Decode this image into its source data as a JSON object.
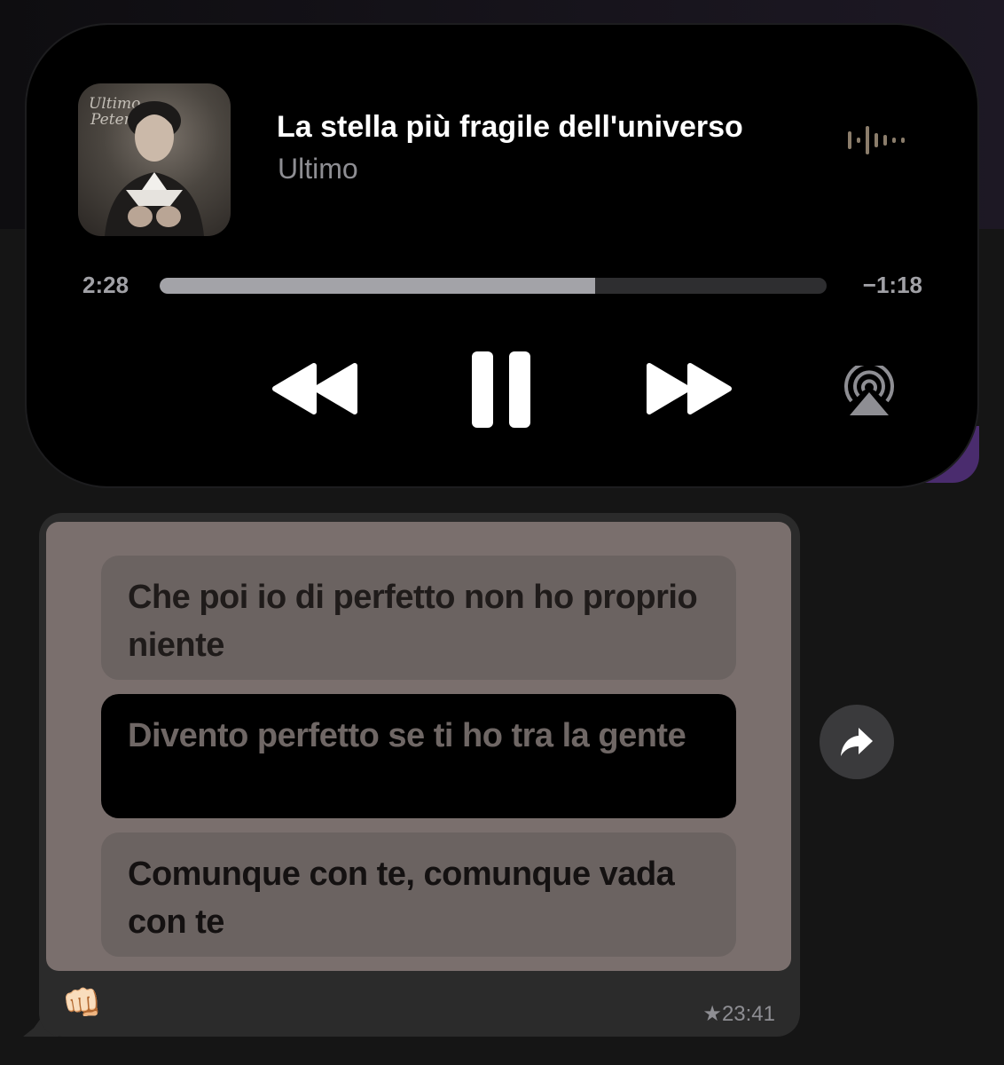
{
  "now_playing": {
    "title": "La stella più fragile dell'universo",
    "artist": "Ultimo",
    "album_art_text": [
      "Ultimo",
      "Peter Pan"
    ],
    "elapsed": "2:28",
    "remaining": "−1:18",
    "progress_fraction": 0.653,
    "controls": {
      "rewind_icon": "backward-icon",
      "pause_icon": "pause-icon",
      "forward_icon": "forward-icon",
      "airplay_icon": "airplay-icon",
      "waveform_icon": "waveform-icon"
    }
  },
  "message": {
    "lyrics": [
      "Che poi io di perfetto non ho proprio niente",
      "Divento perfetto se ti ho tra la gente",
      "Comunque con te, comunque vada con te"
    ],
    "emoji": "👊🏻",
    "timestamp": "★23:41",
    "share_icon": "forward-arrow-icon"
  },
  "colors": {
    "player_bg": "#000000",
    "bubble_bg": "#2b2b2b",
    "lyrics_card_bg": "#7a6f6d",
    "highlight_line_bg": "#000000",
    "accent_purple": "#4a2c6e"
  }
}
